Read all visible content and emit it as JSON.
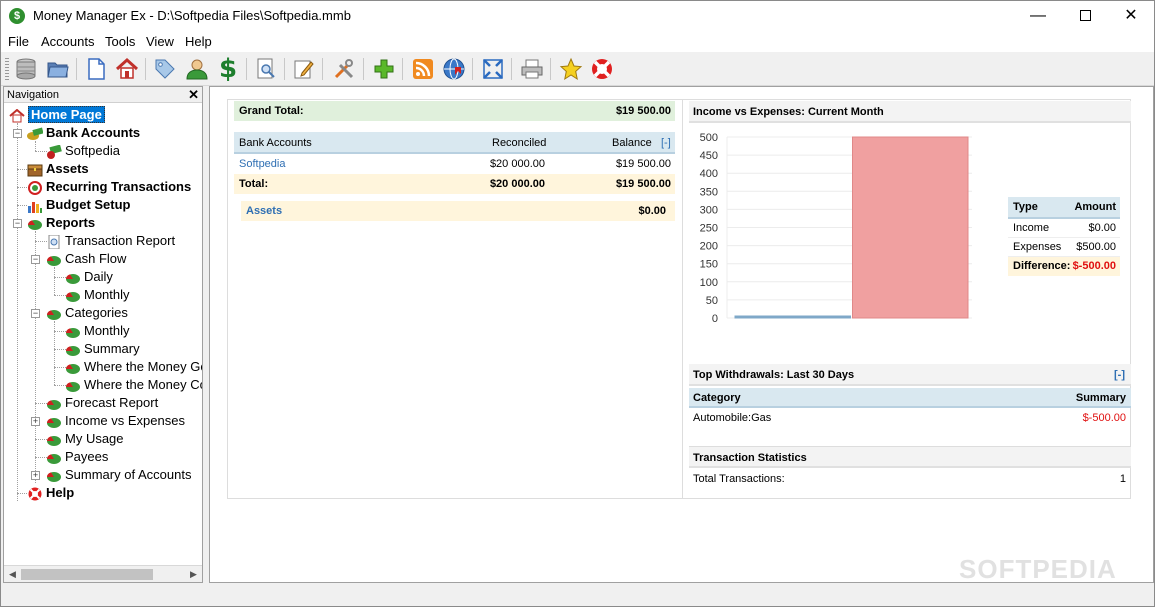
{
  "window": {
    "title": "Money Manager Ex - D:\\Softpedia Files\\Softpedia.mmb",
    "minimize": "—",
    "close": "✕"
  },
  "menu": [
    "File",
    "Accounts",
    "Tools",
    "View",
    "Help"
  ],
  "toolbar": {
    "icons": [
      "database-icon",
      "open-folder-icon",
      "new-document-icon",
      "home-icon",
      "tag-icon",
      "user-icon",
      "dollar-icon",
      "print-preview-icon",
      "edit-icon",
      "tools-icon",
      "add-icon",
      "rss-icon",
      "web-icon",
      "fullscreen-icon",
      "print-icon",
      "favorite-icon",
      "help-lifebuoy-icon"
    ]
  },
  "navigation": {
    "title": "Navigation",
    "close": "✕",
    "items": [
      {
        "label": "Home Page",
        "bold": true,
        "selected": true
      },
      {
        "label": "Bank Accounts",
        "bold": true
      },
      {
        "label": "Softpedia"
      },
      {
        "label": "Assets",
        "bold": true
      },
      {
        "label": "Recurring Transactions",
        "bold": true
      },
      {
        "label": "Budget Setup",
        "bold": true
      },
      {
        "label": "Reports",
        "bold": true
      },
      {
        "label": "Transaction Report"
      },
      {
        "label": "Cash Flow"
      },
      {
        "label": "Daily"
      },
      {
        "label": "Monthly"
      },
      {
        "label": "Categories"
      },
      {
        "label": "Monthly"
      },
      {
        "label": "Summary"
      },
      {
        "label": "Where the Money Goes"
      },
      {
        "label": "Where the Money Comes From"
      },
      {
        "label": "Forecast Report"
      },
      {
        "label": "Income vs Expenses"
      },
      {
        "label": "My Usage"
      },
      {
        "label": "Payees"
      },
      {
        "label": "Summary of Accounts"
      },
      {
        "label": "Help",
        "bold": true
      }
    ]
  },
  "summary": {
    "grand_total_label": "Grand Total:",
    "grand_total_value": "$19 500.00",
    "bank_header": {
      "account": "Bank Accounts",
      "reconciled": "Reconciled",
      "balance": "Balance",
      "toggle": "[-]"
    },
    "bank_rows": [
      {
        "account": "Softpedia",
        "reconciled": "$20 000.00",
        "balance": "$19 500.00"
      }
    ],
    "bank_total": {
      "label": "Total:",
      "reconciled": "$20 000.00",
      "balance": "$19 500.00"
    },
    "assets": {
      "label": "Assets",
      "value": "$0.00"
    }
  },
  "income_chart": {
    "title": "Income vs Expenses: Current Month",
    "legend": {
      "header": {
        "type": "Type",
        "amount": "Amount"
      },
      "rows": [
        {
          "type": "Income",
          "amount": "$0.00"
        },
        {
          "type": "Expenses",
          "amount": "$500.00"
        }
      ],
      "difference": {
        "label": "Difference:",
        "amount": "$-500.00"
      }
    }
  },
  "chart_data": {
    "type": "bar",
    "title": "Income vs Expenses: Current Month",
    "categories": [
      "Income",
      "Expenses"
    ],
    "values": [
      0,
      500
    ],
    "colors": [
      "#7fa8c8",
      "#f0a0a0"
    ],
    "ylim": [
      0,
      500
    ],
    "yticks": [
      0,
      50,
      100,
      150,
      200,
      250,
      300,
      350,
      400,
      450,
      500
    ],
    "grid": true
  },
  "top_withdrawals": {
    "title": "Top Withdrawals: Last 30 Days",
    "toggle": "[-]",
    "header": {
      "category": "Category",
      "summary": "Summary"
    },
    "rows": [
      {
        "category": "Automobile:Gas",
        "summary": "$-500.00"
      }
    ]
  },
  "transaction_stats": {
    "title": "Transaction Statistics",
    "rows": [
      {
        "label": "Total Transactions:",
        "value": "1"
      }
    ]
  },
  "watermark": "SOFTPEDIA"
}
